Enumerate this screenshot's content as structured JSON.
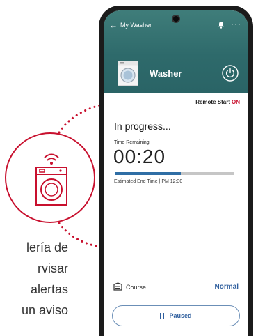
{
  "marketing": {
    "lines": [
      "lería de",
      "rvisar",
      "alertas",
      "un  aviso"
    ],
    "accent_color": "#c8102e"
  },
  "app": {
    "topbar": {
      "back_icon": "back-arrow-icon",
      "title": "My Washer",
      "bell_icon": "bell-icon",
      "more_icon": "more-icon",
      "more_glyph": "···"
    },
    "device": {
      "name": "Washer",
      "thumb_icon": "washer-icon",
      "power_icon": "power-icon"
    },
    "remote_start": {
      "label": "Remote Start",
      "value": "ON"
    },
    "status": "In progress...",
    "time_remaining_label": "Time Remaining",
    "time_remaining": "00:20",
    "progress_fraction": 0.55,
    "estimated_end": "Estimated End Time | PM 12:30",
    "course": {
      "icon": "course-icon",
      "label": "Course",
      "value": "Normal"
    },
    "paused_button": "Paused"
  }
}
